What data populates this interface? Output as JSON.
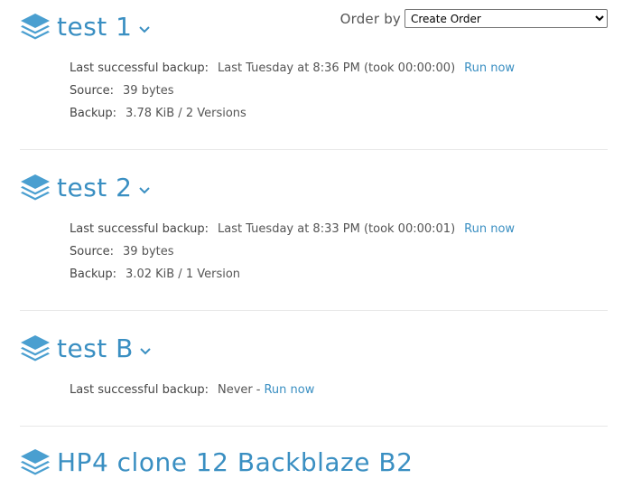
{
  "order": {
    "label": "Order by",
    "selected": "Create Order"
  },
  "backups": [
    {
      "name": "test 1",
      "last_backup_label": "Last successful backup:",
      "last_backup_value": "Last Tuesday at 8:36 PM (took 00:00:00)",
      "run_now": "Run now",
      "source_label": "Source:",
      "source_value": "39 bytes",
      "backup_label": "Backup:",
      "backup_value": "3.78 KiB / 2 Versions"
    },
    {
      "name": "test 2",
      "last_backup_label": "Last successful backup:",
      "last_backup_value": "Last Tuesday at 8:33 PM (took 00:00:01)",
      "run_now": "Run now",
      "source_label": "Source:",
      "source_value": "39 bytes",
      "backup_label": "Backup:",
      "backup_value": "3.02 KiB / 1 Version"
    },
    {
      "name": "test B",
      "last_backup_label": "Last successful backup:",
      "last_backup_value": "Never",
      "separator": "-",
      "run_now": "Run now"
    },
    {
      "name": "HP4 clone 12 Backblaze B2"
    }
  ],
  "colors": {
    "accent": "#3a8fc2",
    "icon": "#4a9fd0"
  }
}
